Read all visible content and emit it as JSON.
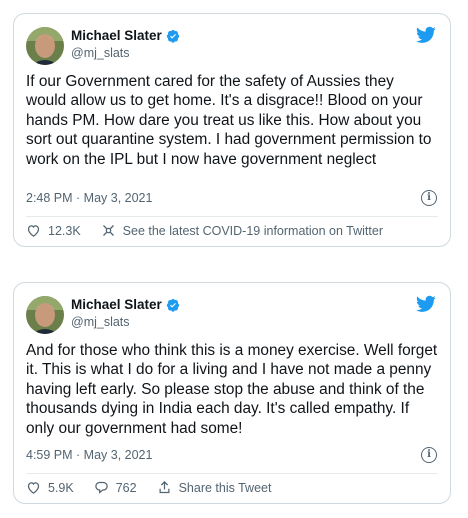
{
  "tweets": [
    {
      "author": {
        "name": "Michael Slater",
        "handle": "@mj_slats",
        "verified": true
      },
      "text": "If our Government cared for the safety of Aussies they would allow us to get home. It's a disgrace!! Blood on your hands PM. How dare you treat us like this. How about you sort out quarantine system. I had government permission to work on the IPL but I now have government neglect",
      "timestamp": "2:48 PM · May 3, 2021",
      "likes": "12.3K",
      "covid_link": "See the latest COVID-19 information on Twitter"
    },
    {
      "author": {
        "name": "Michael Slater",
        "handle": "@mj_slats",
        "verified": true
      },
      "text": "And for those who think this is a money exercise. Well forget it. This is what I do for a living and I have not made a penny having left early. So please stop the abuse and think of the thousands dying in India each day. It's called empathy. If only our government had some!",
      "timestamp": "4:59 PM · May 3, 2021",
      "likes": "5.9K",
      "replies": "762",
      "share_label": "Share this Tweet"
    }
  ],
  "colors": {
    "brand": "#1d9bf0",
    "text": "#0f1419",
    "muted": "#536471",
    "border": "#cfd9de"
  }
}
